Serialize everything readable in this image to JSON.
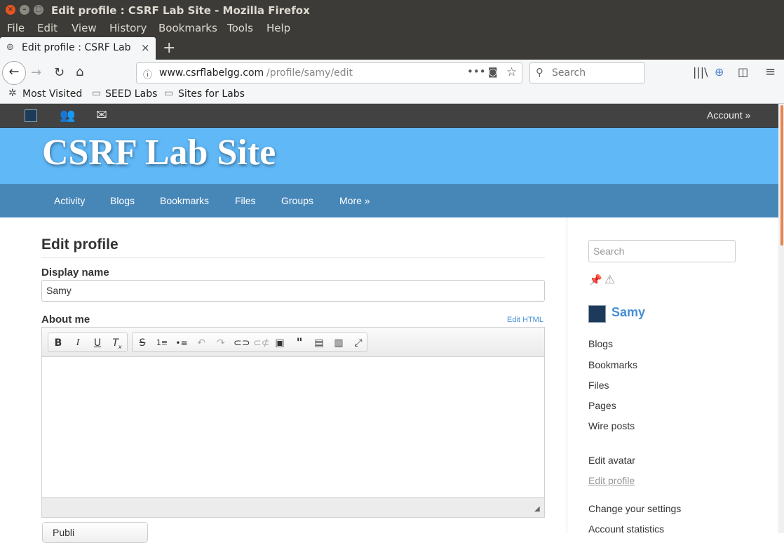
{
  "window": {
    "title": "Edit profile : CSRF Lab Site - Mozilla Firefox"
  },
  "menu": [
    "File",
    "Edit",
    "View",
    "History",
    "Bookmarks",
    "Tools",
    "Help"
  ],
  "tab": {
    "label": "Edit profile : CSRF Lab Si"
  },
  "url": {
    "domain": "www.csrflabelgg.com",
    "path": "/profile/samy/edit"
  },
  "browser_search": {
    "placeholder": "Search"
  },
  "bookmarks": [
    "Most Visited",
    "SEED Labs",
    "Sites for Labs"
  ],
  "topbar": {
    "account": "Account »"
  },
  "site": {
    "title": "CSRF Lab Site",
    "menu": [
      "Activity",
      "Blogs",
      "Bookmarks",
      "Files",
      "Groups",
      "More »"
    ]
  },
  "form": {
    "heading": "Edit profile",
    "display_name_label": "Display name",
    "display_name_value": "Samy",
    "about_label": "About me",
    "edit_html": "Edit HTML",
    "publish": "Publi"
  },
  "sidebar": {
    "search_placeholder": "Search",
    "user": "Samy",
    "links": [
      "Blogs",
      "Bookmarks",
      "Files",
      "Pages",
      "Wire posts"
    ],
    "links2": [
      "Edit avatar",
      "Edit profile"
    ],
    "links3": [
      "Change your settings",
      "Account statistics"
    ]
  }
}
